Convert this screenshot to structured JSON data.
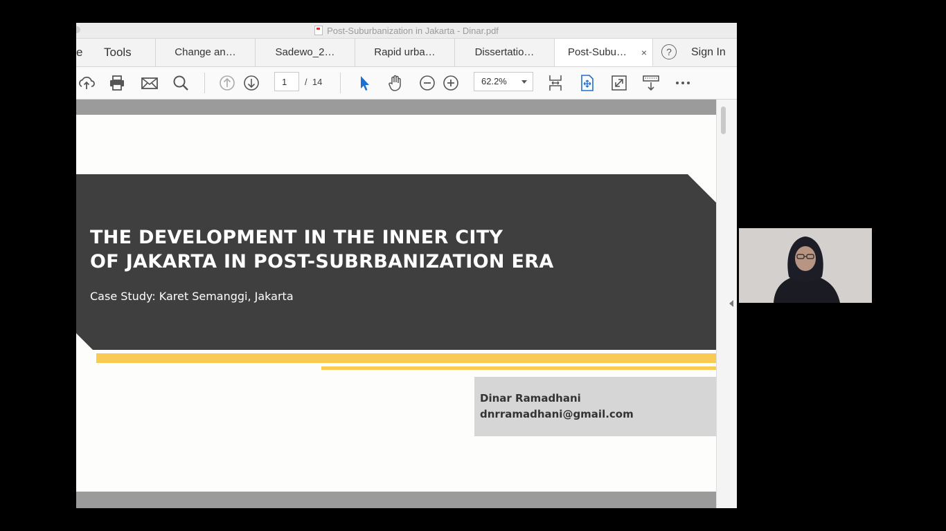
{
  "window": {
    "title": "Post-Suburbanization in Jakarta - Dinar.pdf"
  },
  "tabs": {
    "home_partial": "e",
    "tools": "Tools",
    "items": [
      {
        "label": "Change an…"
      },
      {
        "label": "Sadewo_2…"
      },
      {
        "label": "Rapid urba…"
      },
      {
        "label": "Dissertatio…"
      },
      {
        "label": "Post-Subu…",
        "active": true
      }
    ],
    "close_glyph": "×",
    "help_glyph": "?",
    "sign_in": "Sign In"
  },
  "toolbar": {
    "page_current": "1",
    "page_separator": "/",
    "page_total": "14",
    "zoom": "62.2%",
    "icons": [
      "upload-icon",
      "print-icon",
      "email-icon",
      "search-icon",
      "prev-page-icon",
      "next-page-icon",
      "select-tool-icon",
      "hand-tool-icon",
      "zoom-out-icon",
      "zoom-in-icon",
      "page-view-icon",
      "fit-page-icon",
      "fullscreen-icon",
      "read-mode-icon",
      "more-icon"
    ]
  },
  "slide": {
    "title_line1": "THE DEVELOPMENT IN THE INNER CITY",
    "title_line2": "OF JAKARTA IN POST-SUBRBANIZATION ERA",
    "subtitle": "Case Study: Karet Semanggi, Jakarta",
    "author_name": "Dinar Ramadhani",
    "author_email": "dnrramadhani@gmail.com",
    "colors": {
      "band": "#3f3f3f",
      "accent": "#f9cb55",
      "author_box": "#d6d6d6"
    }
  },
  "webcam": {
    "description_icon": "presenter-video-icon"
  }
}
